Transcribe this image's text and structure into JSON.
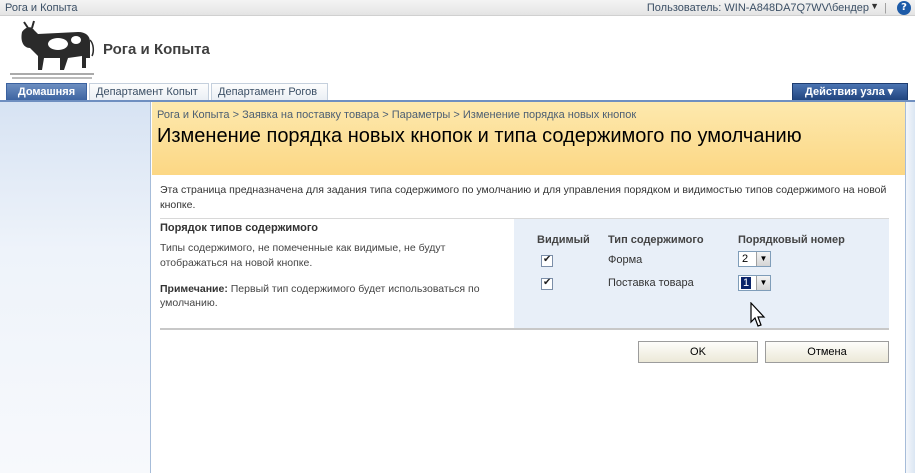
{
  "top": {
    "site_link": "Рога и Копыта",
    "user": "Пользователь: WIN-A848DA7Q7WV\\бендер",
    "separator": "|",
    "help": "?"
  },
  "header": {
    "title": "Рога и Копыта"
  },
  "tabs": [
    {
      "label": "Домашняя",
      "selected": true
    },
    {
      "label": "Департамент Копыт"
    },
    {
      "label": "Департамент Рогов"
    }
  ],
  "site_actions": {
    "label": "Действия узла ▾"
  },
  "breadcrumb": "Рога и Копыта > Заявка на поставку товара > Параметры > Изменение порядка новых кнопок",
  "page_title": "Изменение порядка новых кнопок и типа содержимого по умолчанию",
  "description": "Эта страница предназначена для задания типа содержимого по умолчанию и для управления порядком и видимостью типов содержимого на новой кнопке.",
  "section": {
    "heading": "Порядок типов содержимого",
    "text": "Типы содержимого, не помеченные как видимые, не будут отображаться на новой кнопке.",
    "note_label": "Примечание:",
    "note_text": " Первый тип содержимого будет использоваться по умолчанию."
  },
  "table": {
    "headers": {
      "visible": "Видимый",
      "type": "Тип содержимого",
      "order": "Порядковый номер"
    },
    "rows": [
      {
        "visible": true,
        "name": "Форма",
        "order": "2"
      },
      {
        "visible": true,
        "name": "Поставка товара",
        "order": "1"
      }
    ]
  },
  "buttons": {
    "ok": "OK",
    "cancel": "Отмена"
  },
  "colors": {
    "title_band": "#fcd784",
    "tab_selected": "#3b62a0",
    "settings_panel": "#e8eff8"
  }
}
